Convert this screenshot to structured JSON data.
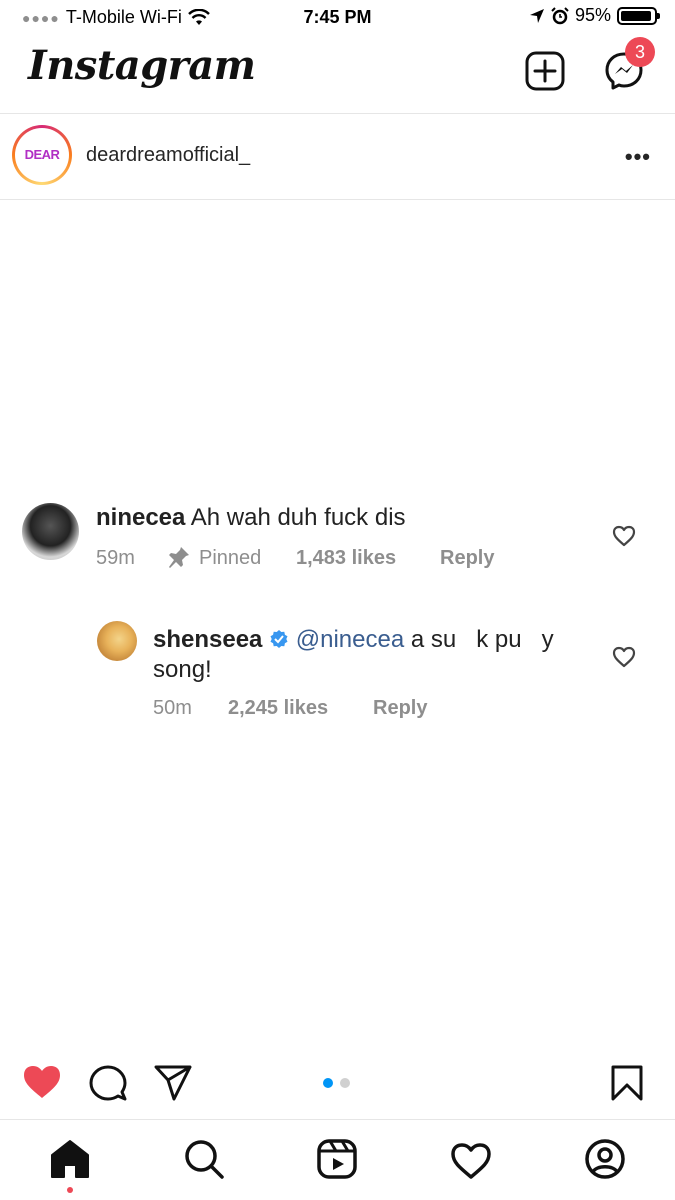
{
  "status_bar": {
    "carrier": "T-Mobile Wi-Fi",
    "time": "7:45 PM",
    "battery_text": "95%",
    "battery_level": 0.95
  },
  "app_header": {
    "logo": "Instagram",
    "messages_badge": "3"
  },
  "post_header": {
    "avatar_text": "DEAR",
    "username": "deardreamofficial_"
  },
  "comments": [
    {
      "username": "ninecea",
      "text": "Ah wah duh fuck dis",
      "time": "59m",
      "pinned_label": "Pinned",
      "likes": "1,483 likes",
      "reply_label": "Reply"
    },
    {
      "username": "shenseea",
      "mention": "@ninecea",
      "text_line1": "a su   k pu   y",
      "text_line2": "song!",
      "time": "50m",
      "likes": "2,245 likes",
      "reply_label": "Reply"
    }
  ],
  "carousel": {
    "count": 2,
    "active": 0
  },
  "colors": {
    "like_red": "#ed4956",
    "carousel_active": "#0095f6",
    "verified_blue": "#3897f0"
  },
  "icons": {
    "actions": [
      "heart-filled-icon",
      "comment-icon",
      "share-icon",
      "bookmark-icon"
    ],
    "nav": [
      "home-icon",
      "search-icon",
      "reels-icon",
      "heart-icon",
      "profile-icon"
    ]
  }
}
